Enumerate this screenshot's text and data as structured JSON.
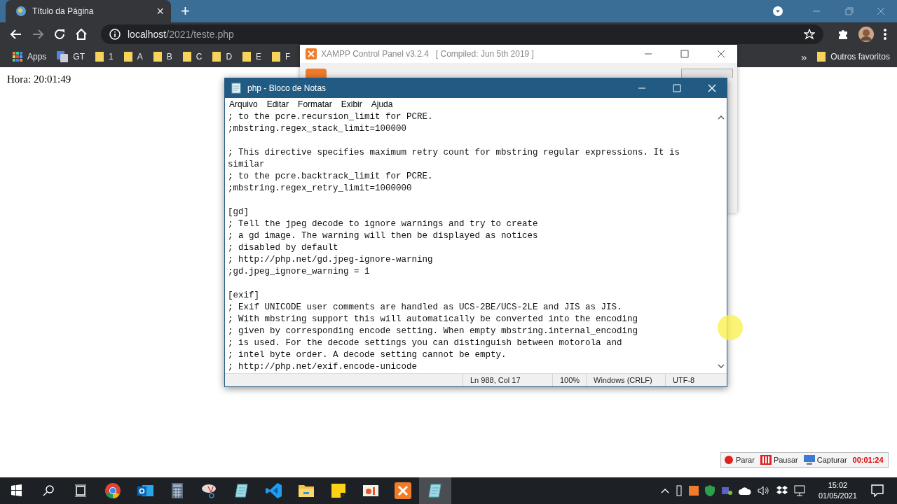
{
  "browser": {
    "tab": {
      "title": "Título da Página",
      "close": "×"
    },
    "new_tab": "+",
    "address": {
      "host": "localhost",
      "path": "/2021/teste.php"
    },
    "bookmarks": [
      {
        "label": "Apps",
        "kind": "apps"
      },
      {
        "label": "GT",
        "kind": "translate"
      },
      {
        "label": "1",
        "kind": "folder"
      },
      {
        "label": "A",
        "kind": "folder"
      },
      {
        "label": "B",
        "kind": "folder"
      },
      {
        "label": "C",
        "kind": "folder"
      },
      {
        "label": "D",
        "kind": "folder"
      },
      {
        "label": "E",
        "kind": "folder"
      },
      {
        "label": "F",
        "kind": "folder"
      }
    ],
    "more": "»",
    "other_bookmarks": "Outros favoritos"
  },
  "page": {
    "text": "Hora: 20:01:49"
  },
  "xampp": {
    "title": "XAMPP Control Panel v3.2.4   [ Compiled: Jun 5th 2019 ]"
  },
  "notepad": {
    "title": "php - Bloco de Notas",
    "menu": [
      "Arquivo",
      "Editar",
      "Formatar",
      "Exibir",
      "Ajuda"
    ],
    "paragraphs": [
      [
        "; to the pcre.recursion_limit for PCRE.",
        ";mbstring.regex_stack_limit=100000"
      ],
      [
        "; This directive specifies maximum retry count for mbstring regular expressions. It is",
        "similar",
        "; to the pcre.backtrack_limit for PCRE.",
        ";mbstring.regex_retry_limit=1000000"
      ],
      [
        "[gd]",
        "; Tell the jpeg decode to ignore warnings and try to create",
        "; a gd image. The warning will then be displayed as notices",
        "; disabled by default",
        "; http://php.net/gd.jpeg-ignore-warning",
        ";gd.jpeg_ignore_warning = 1"
      ],
      [
        "[exif]",
        "; Exif UNICODE user comments are handled as UCS-2BE/UCS-2LE and JIS as JIS.",
        "; With mbstring support this will automatically be converted into the encoding",
        "; given by corresponding encode setting. When empty mbstring.internal_encoding",
        "; is used. For the decode settings you can distinguish between motorola and",
        "; intel byte order. A decode setting cannot be empty.",
        "; http://php.net/exif.encode-unicode"
      ]
    ],
    "status": {
      "position": "Ln 988, Col 17",
      "zoom": "100%",
      "line_ending": "Windows (CRLF)",
      "encoding": "UTF-8"
    }
  },
  "recorder": {
    "buttons": [
      {
        "label": "Parar",
        "kind": "stop"
      },
      {
        "label": "Pausar",
        "kind": "pause"
      },
      {
        "label": "Capturar",
        "kind": "capture"
      }
    ],
    "timer": "00:01:24"
  },
  "taskbar": {
    "apps": [
      {
        "kind": "chrome",
        "selected": false
      },
      {
        "kind": "outlook",
        "selected": false
      },
      {
        "kind": "calculator",
        "selected": false
      },
      {
        "kind": "snipping",
        "selected": false
      },
      {
        "kind": "notepad",
        "selected": false
      },
      {
        "kind": "vscode",
        "selected": false
      },
      {
        "kind": "explorer",
        "selected": false
      },
      {
        "kind": "sticky",
        "selected": false
      },
      {
        "kind": "slides",
        "selected": false
      },
      {
        "kind": "xampp",
        "selected": false
      },
      {
        "kind": "notepad",
        "selected": true
      }
    ],
    "time": "15:02",
    "date": "01/05/2021"
  }
}
